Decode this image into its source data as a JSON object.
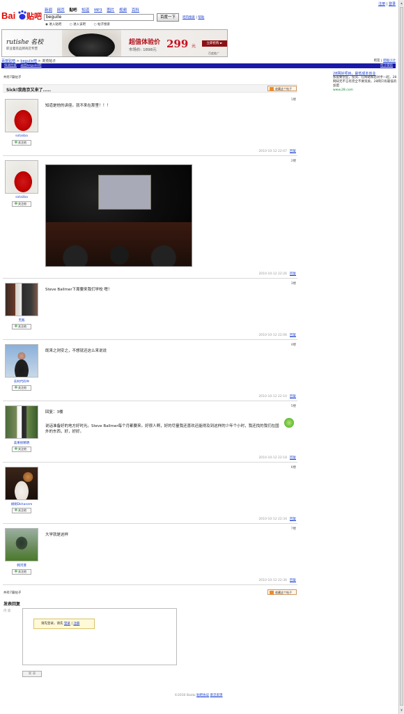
{
  "toplinks": [
    "注册",
    "登录"
  ],
  "logo": {
    "text_a": "Bai",
    "text_b": "贴吧"
  },
  "nav": [
    "新闻",
    "网页",
    "贴吧",
    "知道",
    "MP3",
    "图片",
    "视频",
    "百科"
  ],
  "nav_current_index": 2,
  "search": {
    "value": "beguile",
    "button": "百度一下",
    "links": [
      "吧内搜索",
      "帮助"
    ]
  },
  "radios": [
    "进入贴吧",
    "进入该吧",
    "帖子搜索"
  ],
  "banner": {
    "brand": "rutishe 名校",
    "brand_sub": "职业着装品牌商店专营",
    "title": "超值体验价",
    "market": "市场价: 1898元",
    "price": "299",
    "yuan": "元",
    "buy": "立即抢购 ►",
    "tag": "百度推广"
  },
  "breadcrumb": [
    "百度贴吧",
    "beguile吧",
    "浏览帖子"
  ],
  "breadcrumb_right": [
    "吧友",
    "吧规小计"
  ],
  "bluebar": {
    "left": [
      "快速回复",
      "返回beguile吧"
    ],
    "right": "抢沙发帖"
  },
  "sidebar": {
    "title": "28网好项目，最低成本创业",
    "desc": "加盟要创业，投资、在网站和您对手一起，28网知无不言有完全不要资质，28网只有最低的加盟",
    "url": "www.28.com"
  },
  "count_top": "共有7篇帖子",
  "count_bottom": "共有7篇帖子",
  "thread_title": "Sick!我南京又来了.....",
  "fav_label": "收藏这个帖子",
  "follow_label": "关注他",
  "reply_label": "回复",
  "posts": [
    {
      "user": "sotaiiba",
      "floor": "1楼",
      "text": "知道是他的讲座。就不来在那里！！！",
      "time": "2010-10-12 22:07"
    },
    {
      "user": "sotaiiba",
      "floor": "2楼",
      "text": "",
      "time": "2010-10-12 22:26"
    },
    {
      "user": "无敌",
      "floor": "3楼",
      "text": "Steve Ballmer下周要来我们学校 嗯！",
      "time": "2010-10-12 22:06"
    },
    {
      "user": "农村代码牛",
      "floor": "4楼",
      "text": "既来之则安之，不想就还这么来说说",
      "time": "2010-10-12 22:10"
    },
    {
      "user": "美果很精明",
      "floor": "5楼",
      "text": "回复：3楼",
      "text2": "说话准备好的地方好时光。Steve Ballmer每个月都要来。好很人啊，好的尽量我还喜欢还能得及到这样的少年个小时，我还找的我们在国外的东西，好，好好。",
      "time": "2010-10-12 22:18"
    },
    {
      "user": "胡胡Dkhanem",
      "floor": "6楼",
      "text": "",
      "time": "2010-10-12 22:34"
    },
    {
      "user": "韩河港",
      "floor": "7楼",
      "text": "大学就是这样",
      "time": "2010-10-12 22:36"
    }
  ],
  "reply": {
    "title": "发表回复",
    "label": "内 容",
    "tip": "请先登录，请先",
    "tip_login": "登录",
    "tip_sep": "|",
    "tip_reg": "注册",
    "submit": "发 表"
  },
  "footer": {
    "copy": "©2010 Baidu",
    "links": [
      "贴吧协议",
      "意见反馈"
    ]
  }
}
